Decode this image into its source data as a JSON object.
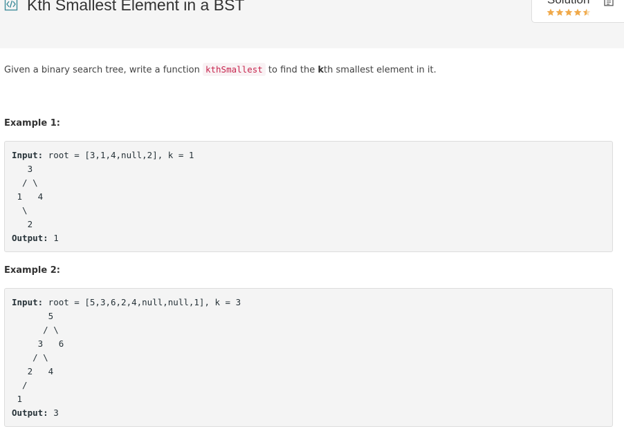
{
  "problem": {
    "title": "Kth Smallest Element in a BST"
  },
  "solution": {
    "label": "Solution",
    "rating": 4.5
  },
  "description": {
    "prefix": "Given a binary search tree, write a function ",
    "function_name": "kthSmallest",
    "middle": " to find the ",
    "bold_k": "k",
    "suffix": "th smallest element in it."
  },
  "examples": [
    {
      "heading": "Example 1:",
      "input_label": "Input:",
      "input_value": " root = [3,1,4,null,2], k = 1",
      "tree_lines": [
        "   3",
        "  / \\",
        " 1   4",
        "  \\",
        "   2"
      ],
      "output_label": "Output:",
      "output_value": " 1"
    },
    {
      "heading": "Example 2:",
      "input_label": "Input:",
      "input_value": " root = [5,3,6,2,4,null,null,1], k = 3",
      "tree_lines": [
        "       5",
        "      / \\",
        "     3   6",
        "    / \\",
        "   2   4",
        "  /",
        " 1"
      ],
      "output_label": "Output:",
      "output_value": " 3"
    }
  ],
  "colors": {
    "header_bg": "#f5f5f5",
    "code_bg": "#f4f4f4",
    "inline_code": "#c7254e",
    "star": "#f0a94a",
    "title_icon": "#3e8c9a"
  },
  "icons": {
    "title_icon": "code-file-icon",
    "solution_icon": "document-icon",
    "rating_icon": "star-icon"
  }
}
